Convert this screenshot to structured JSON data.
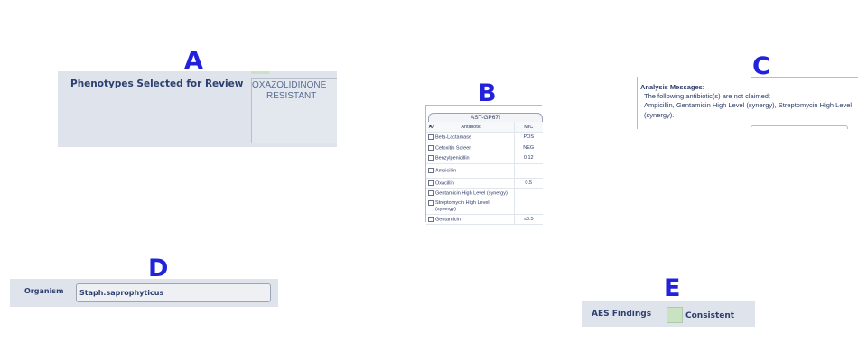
{
  "letters": {
    "a": "A",
    "b": "B",
    "c": "C",
    "d": "D",
    "e": "E"
  },
  "panel_a": {
    "heading": "Phenotypes Selected for Review",
    "phenotype_line1": "OXAZOLIDINONE",
    "phenotype_line2": "RESISTANT"
  },
  "panel_b": {
    "card_tab": "AST-GP67",
    "card_alert": "!",
    "columns": {
      "antibiotic": "Antibiotic",
      "mic": "MIC"
    },
    "rows": [
      {
        "name": "Beta-Lactamase",
        "mic": "POS"
      },
      {
        "name": "Cefoxitin Screen",
        "mic": "NEG"
      },
      {
        "name": "Benzylpenicillin",
        "mic": "0.12"
      },
      {
        "name": "Ampicillin",
        "mic": ""
      },
      {
        "name": "Oxacillin",
        "mic": "0.5"
      },
      {
        "name": "Gentamicin High Level (synergy)",
        "mic": ""
      },
      {
        "name_line1": "Streptomycin High Level",
        "name_line2": "(synergy)",
        "mic": ""
      },
      {
        "name": "Gentamicin",
        "mic": "≤0.5"
      }
    ]
  },
  "panel_c": {
    "title": "Analysis Messages:",
    "line1": "The following antibiotic(s) are not claimed:",
    "line2": "Ampicillin, Gentamicin High Level (synergy), Streptomycin High Level",
    "line3": "(synergy)."
  },
  "panel_d": {
    "label": "Organism",
    "value": "Staph.saprophyticus"
  },
  "panel_e": {
    "label": "AES Findings",
    "value": "Consistent",
    "status_color": "#c9e3c2"
  }
}
